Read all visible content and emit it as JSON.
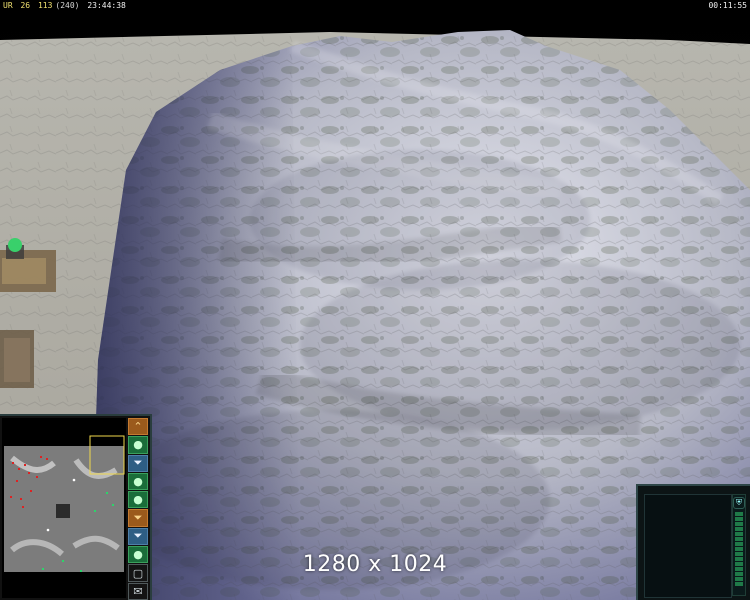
{
  "hud": {
    "faction": "UR",
    "counter_a": "26",
    "resource_current": "113",
    "resource_capacity": "(240)",
    "clock_left": "23:44:38",
    "clock_right": "00:11:55"
  },
  "overlay": {
    "resolution_label": "1280 x 1024"
  },
  "colors": {
    "terrain_light": "#c8c8d2",
    "terrain_shadow": "#4a4c70",
    "moss": "#3f4b2e",
    "hud_text_gold": "#f0e070",
    "panel_border": "#2e4648",
    "accent_green": "#1a6d3a",
    "accent_orange": "#9b5a1c",
    "accent_blue": "#2e5e84"
  },
  "minimap": {
    "buttons": [
      {
        "name": "orange-rank-button",
        "style": "orange",
        "icon": "chevron-up-icon"
      },
      {
        "name": "green-unit-button-1",
        "style": "green",
        "icon": "circle-icon"
      },
      {
        "name": "blue-filter-button-1",
        "style": "blue",
        "icon": "filter-icon"
      },
      {
        "name": "green-unit-button-2",
        "style": "green",
        "icon": "circle-icon"
      },
      {
        "name": "green-unit-button-3",
        "style": "green",
        "icon": "circle-icon"
      },
      {
        "name": "orange-filter-button",
        "style": "orange",
        "icon": "filter-icon"
      },
      {
        "name": "blue-filter-button-2",
        "style": "blue",
        "icon": "filter-icon"
      },
      {
        "name": "green-unit-button-4",
        "style": "green",
        "icon": "circle-icon"
      },
      {
        "name": "window-toggle-button",
        "style": "dark",
        "icon": "windows-icon"
      },
      {
        "name": "chat-button",
        "style": "dark",
        "icon": "chat-icon"
      }
    ]
  }
}
